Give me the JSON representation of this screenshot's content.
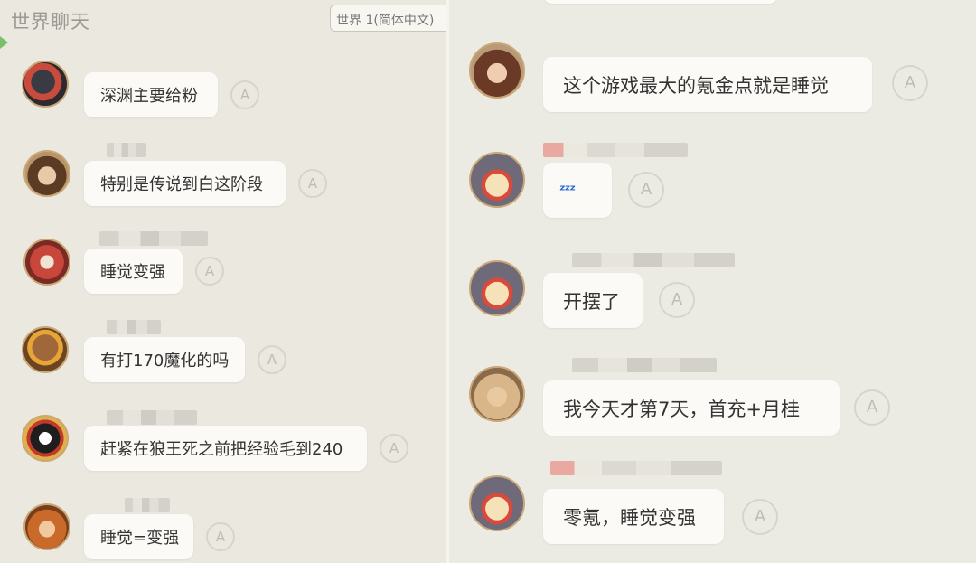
{
  "left": {
    "title": "世界聊天",
    "channel": "世界 1(简体中文)",
    "messages": [
      {
        "text": "深渊主要给粉",
        "avatar": "dark-armored-avatar-icon"
      },
      {
        "text": "特别是传说到白这阶段",
        "avatar": "brown-haired-man-avatar-icon"
      },
      {
        "text": "睡觉变强",
        "avatar": "red-masked-avatar-icon"
      },
      {
        "text": "有打170魔化的吗",
        "avatar": "bear-avatar-icon"
      },
      {
        "text": "赶紧在狼王死之前把经验毛到240",
        "avatar": "black-white-mask-avatar-icon"
      },
      {
        "text": "睡觉=变强",
        "avatar": "orange-hair-avatar-icon"
      }
    ]
  },
  "right": {
    "messages": [
      {
        "text": "这个游戏最大的氪金点就是睡觉",
        "avatar": "woman-avatar-icon"
      },
      {
        "text": "ᶻᶻᶻ",
        "avatar": "hooded-chick-avatar-icon"
      },
      {
        "text": "开摆了",
        "avatar": "hooded-chick-avatar-icon"
      },
      {
        "text": "我今天才第7天，首充+月桂",
        "avatar": "blonde-beast-avatar-icon"
      },
      {
        "text": "零氪，睡觉变强",
        "avatar": "hooded-chick-avatar-icon"
      }
    ]
  },
  "colors": {
    "background": "#ebe8df",
    "bubble": "#fbfaf6",
    "zzz": "#2c6bd3",
    "avatar_border": "#caa777"
  },
  "translate_label": "A"
}
